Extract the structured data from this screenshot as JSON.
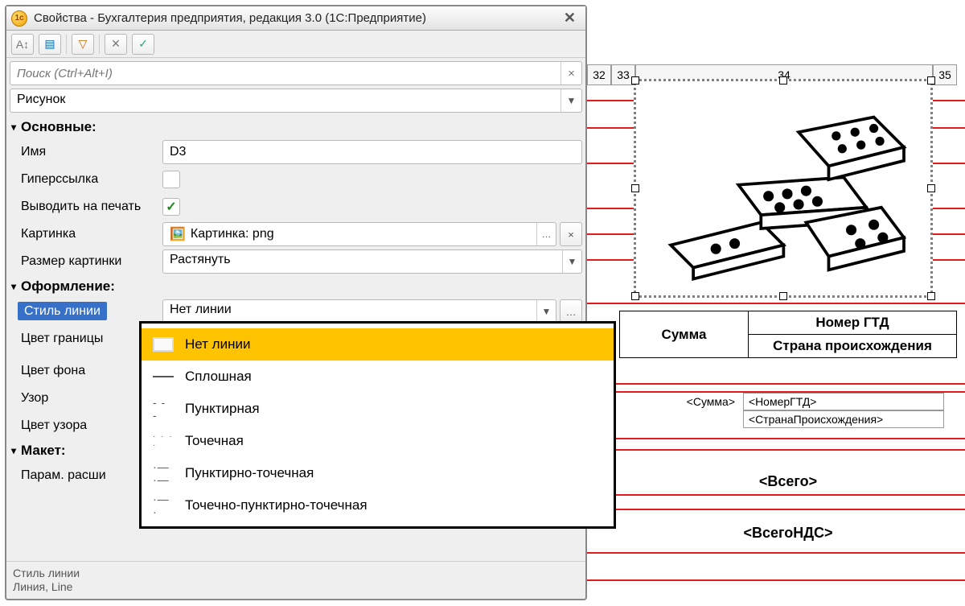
{
  "window": {
    "title": "Свойства - Бухгалтерия предприятия, редакция 3.0  (1С:Предприятие)"
  },
  "search": {
    "placeholder": "Поиск (Ctrl+Alt+I)"
  },
  "type_select": "Рисунок",
  "sections": {
    "main": "Основные:",
    "format": "Оформление:",
    "layout": "Макет:"
  },
  "props": {
    "name_label": "Имя",
    "name_value": "D3",
    "hyper_label": "Гиперссылка",
    "print_label": "Выводить на печать",
    "pic_label": "Картинка",
    "pic_value": "Картинка: png",
    "size_label": "Размер картинки",
    "size_value": "Растянуть",
    "line_label": "Стиль линии",
    "line_value": "Нет линии",
    "border_color_label": "Цвет границы",
    "bg_label": "Цвет фона",
    "pattern_label": "Узор",
    "pattern_color_label": "Цвет узора",
    "ext_label": "Парам. расши"
  },
  "line_styles": {
    "none": "Нет линии",
    "solid": "Сплошная",
    "dashed": "Пунктирная",
    "dotted": "Точечная",
    "dashdot": "Пунктирно-точечная",
    "dotdashdot": "Точечно-пунктирно-точечная"
  },
  "status": {
    "l1": "Стиль линии",
    "l2": "Линия, Line"
  },
  "sheet": {
    "cols": {
      "c32": "32",
      "c33": "33",
      "c34": "34",
      "c35": "35"
    },
    "table": {
      "sum": "Сумма",
      "gtd": "Номер ГТД",
      "country": "Страна происхождения"
    },
    "refs": {
      "sum": "<Сумма>",
      "gtd": "<НомерГТД>",
      "country": "<СтранаПроисхождения>",
      "total": "<Всего>",
      "vat": "<ВсегоНДС>"
    }
  }
}
